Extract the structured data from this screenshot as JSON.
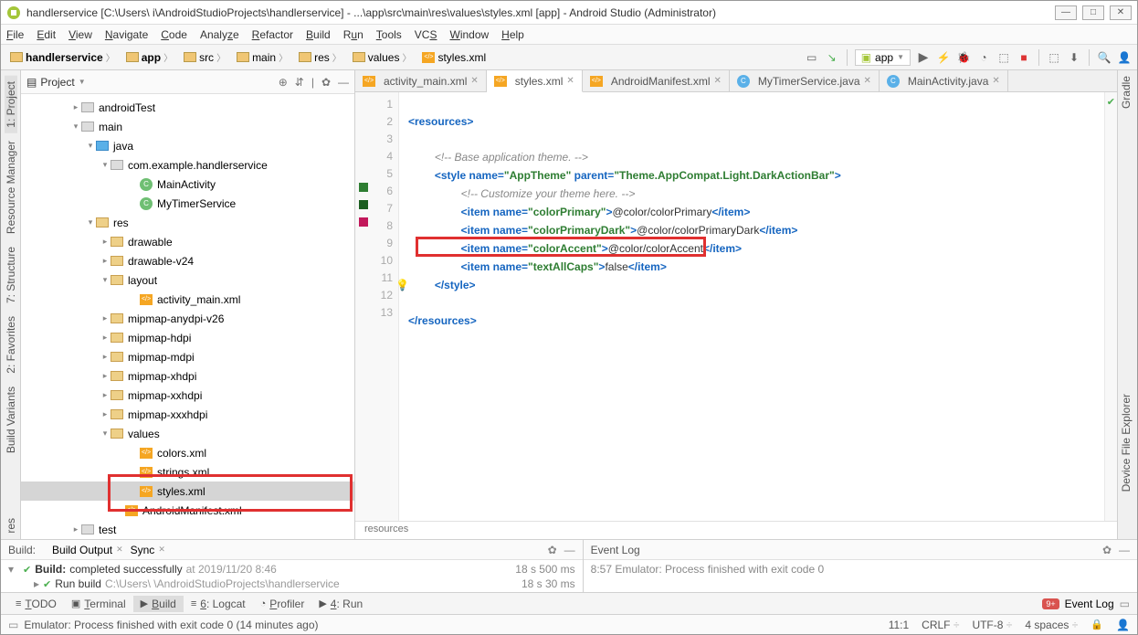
{
  "titlebar": {
    "text": "handlerservice [C:\\Users\\           i\\AndroidStudioProjects\\handlerservice] - ...\\app\\src\\main\\res\\values\\styles.xml [app] - Android Studio (Administrator)"
  },
  "menus": [
    "File",
    "Edit",
    "View",
    "Navigate",
    "Code",
    "Analyze",
    "Refactor",
    "Build",
    "Run",
    "Tools",
    "VCS",
    "Window",
    "Help"
  ],
  "breadcrumb": [
    {
      "icon": "folder",
      "label": "handlerservice"
    },
    {
      "icon": "folder",
      "label": "app"
    },
    {
      "icon": "folder",
      "label": "src"
    },
    {
      "icon": "folder",
      "label": "main"
    },
    {
      "icon": "folder",
      "label": "res"
    },
    {
      "icon": "folder",
      "label": "values"
    },
    {
      "icon": "xml",
      "label": "styles.xml"
    }
  ],
  "run_config": {
    "label": "app"
  },
  "left_tools": [
    {
      "label": "1: Project"
    },
    {
      "label": "Resource Manager"
    },
    {
      "label": "7: Structure"
    },
    {
      "label": "2: Favorites"
    },
    {
      "label": "Build Variants"
    },
    {
      "label": "res"
    }
  ],
  "project_panel": {
    "title": "Project",
    "tree": [
      {
        "indent": 3,
        "tw": "▸",
        "type": "folder-gray",
        "label": "androidTest"
      },
      {
        "indent": 3,
        "tw": "▾",
        "type": "folder-gray",
        "label": "main"
      },
      {
        "indent": 4,
        "tw": "▾",
        "type": "folder-blue",
        "label": "java"
      },
      {
        "indent": 5,
        "tw": "▾",
        "type": "folder-gray",
        "label": "com.example.handlerservice"
      },
      {
        "indent": 7,
        "tw": "",
        "type": "java",
        "label": "MainActivity"
      },
      {
        "indent": 7,
        "tw": "",
        "type": "java",
        "label": "MyTimerService"
      },
      {
        "indent": 4,
        "tw": "▾",
        "type": "folder-res",
        "label": "res"
      },
      {
        "indent": 5,
        "tw": "▸",
        "type": "folder-res",
        "label": "drawable"
      },
      {
        "indent": 5,
        "tw": "▸",
        "type": "folder-res",
        "label": "drawable-v24"
      },
      {
        "indent": 5,
        "tw": "▾",
        "type": "folder-res",
        "label": "layout"
      },
      {
        "indent": 7,
        "tw": "",
        "type": "xml",
        "label": "activity_main.xml"
      },
      {
        "indent": 5,
        "tw": "▸",
        "type": "folder-res",
        "label": "mipmap-anydpi-v26"
      },
      {
        "indent": 5,
        "tw": "▸",
        "type": "folder-res",
        "label": "mipmap-hdpi"
      },
      {
        "indent": 5,
        "tw": "▸",
        "type": "folder-res",
        "label": "mipmap-mdpi"
      },
      {
        "indent": 5,
        "tw": "▸",
        "type": "folder-res",
        "label": "mipmap-xhdpi"
      },
      {
        "indent": 5,
        "tw": "▸",
        "type": "folder-res",
        "label": "mipmap-xxhdpi"
      },
      {
        "indent": 5,
        "tw": "▸",
        "type": "folder-res",
        "label": "mipmap-xxxhdpi"
      },
      {
        "indent": 5,
        "tw": "▾",
        "type": "folder-res",
        "label": "values"
      },
      {
        "indent": 7,
        "tw": "",
        "type": "xml",
        "label": "colors.xml"
      },
      {
        "indent": 7,
        "tw": "",
        "type": "xml",
        "label": "strings.xml"
      },
      {
        "indent": 7,
        "tw": "",
        "type": "xml",
        "label": "styles.xml",
        "selected": true
      },
      {
        "indent": 6,
        "tw": "",
        "type": "xml",
        "label": "AndroidManifest.xml"
      },
      {
        "indent": 3,
        "tw": "▸",
        "type": "folder-gray",
        "label": "test"
      }
    ]
  },
  "editor": {
    "tabs": [
      {
        "icon": "xml",
        "label": "activity_main.xml",
        "close": true
      },
      {
        "icon": "xml",
        "label": "styles.xml",
        "close": true,
        "active": true
      },
      {
        "icon": "xml",
        "label": "AndroidManifest.xml",
        "close": true
      },
      {
        "icon": "java",
        "label": "MyTimerService.java",
        "close": true
      },
      {
        "icon": "java",
        "label": "MainActivity.java",
        "close": true
      }
    ],
    "line_count": 13,
    "breadcrumb_bottom": "resources",
    "lines": {
      "l1_open": "<",
      "l1_tag": "resources",
      "l1_close": ">",
      "l3_comment": "<!-- Base application theme. -->",
      "l4_a": "<",
      "l4_tag": "style",
      "l4_sp": " ",
      "l4_attr1": "name=",
      "l4_v1": "\"AppTheme\"",
      "l4_sp2": " ",
      "l4_attr2": "parent=",
      "l4_v2": "\"Theme.AppCompat.Light.DarkActionBar\"",
      "l4_close": ">",
      "l5_comment": "<!-- Customize your theme here. -->",
      "l6_a": "<",
      "l6_tag": "item",
      "l6_sp": " ",
      "l6_attr": "name=",
      "l6_v": "\"colorPrimary\"",
      "l6_c": ">",
      "l6_text": "@color/colorPrimary",
      "l6_e": "</",
      "l6_tag2": "item",
      "l6_ec": ">",
      "l7_a": "<",
      "l7_tag": "item",
      "l7_sp": " ",
      "l7_attr": "name=",
      "l7_v": "\"colorPrimaryDark\"",
      "l7_c": ">",
      "l7_text": "@color/colorPrimaryDark",
      "l7_e": "</",
      "l7_tag2": "item",
      "l7_ec": ">",
      "l8_a": "<",
      "l8_tag": "item",
      "l8_sp": " ",
      "l8_attr": "name=",
      "l8_v": "\"colorAccent\"",
      "l8_c": ">",
      "l8_text": "@color/colorAccent",
      "l8_e": "</",
      "l8_tag2": "item",
      "l8_ec": ">",
      "l9_a": "<",
      "l9_tag": "item",
      "l9_sp": " ",
      "l9_attr": "name=",
      "l9_v": "\"textAllCaps\"",
      "l9_c": ">",
      "l9_text": "false",
      "l9_e": "</",
      "l9_tag2": "item",
      "l9_ec": ">",
      "l10_a": "</",
      "l10_tag": "style",
      "l10_c": ">",
      "l12_a": "</",
      "l12_tag": "resources",
      "l12_c": ">"
    }
  },
  "build_panel": {
    "title": "Build:",
    "sub1": "Build Output",
    "sub2": "Sync",
    "row1_a": "Build:",
    "row1_b": " completed successfully",
    "row1_c": " at 2019/11/20 8:46",
    "row1_time": "18 s 500 ms",
    "row2_a": "Run build",
    "row2_b": " C:\\Users\\              \\AndroidStudioProjects\\handlerservice",
    "row2_time": "18 s 30 ms"
  },
  "event_log": {
    "title": "Event Log",
    "row": "8:57  Emulator: Process finished with exit code 0"
  },
  "bottom_tools": [
    {
      "icon": "≡",
      "label": "TODO"
    },
    {
      "icon": "▣",
      "label": "Terminal"
    },
    {
      "icon": "▶",
      "label": "Build",
      "active": true
    },
    {
      "icon": "≡",
      "label": "6: Logcat"
    },
    {
      "icon": "◔",
      "label": "Profiler"
    },
    {
      "icon": "▶",
      "label": "4: Run"
    }
  ],
  "event_badge": "9+",
  "event_label": "Event Log",
  "status": {
    "msg": "Emulator: Process finished with exit code 0 (14 minutes ago)",
    "pos": "11:1",
    "eol": "CRLF",
    "sep": "÷",
    "enc": "UTF-8",
    "sep2": "÷",
    "indent": "4 spaces",
    "sep3": "÷"
  },
  "right_tools": [
    {
      "label": "Gradle"
    },
    {
      "label": "Device File Explorer"
    }
  ]
}
